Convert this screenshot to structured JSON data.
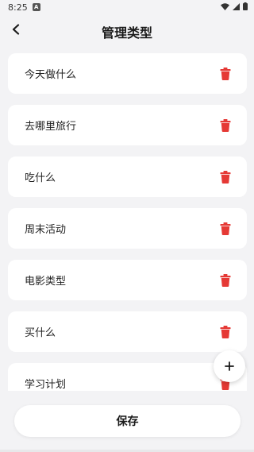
{
  "status_bar": {
    "time": "8:25",
    "badge": "A",
    "icons": [
      "wifi-icon",
      "signal-icon",
      "battery-icon"
    ]
  },
  "header": {
    "back_icon": "chevron-left-icon",
    "title": "管理类型"
  },
  "items": [
    {
      "label": "今天做什么"
    },
    {
      "label": "去哪里旅行"
    },
    {
      "label": "吃什么"
    },
    {
      "label": "周末活动"
    },
    {
      "label": "电影类型"
    },
    {
      "label": "买什么"
    },
    {
      "label": "学习计划"
    }
  ],
  "delete_icon": "trash-icon",
  "fab": {
    "icon": "plus-icon"
  },
  "save_label": "保存",
  "colors": {
    "background": "#f3f3f5",
    "card": "#ffffff",
    "delete": "#e53935",
    "text": "#222222"
  }
}
